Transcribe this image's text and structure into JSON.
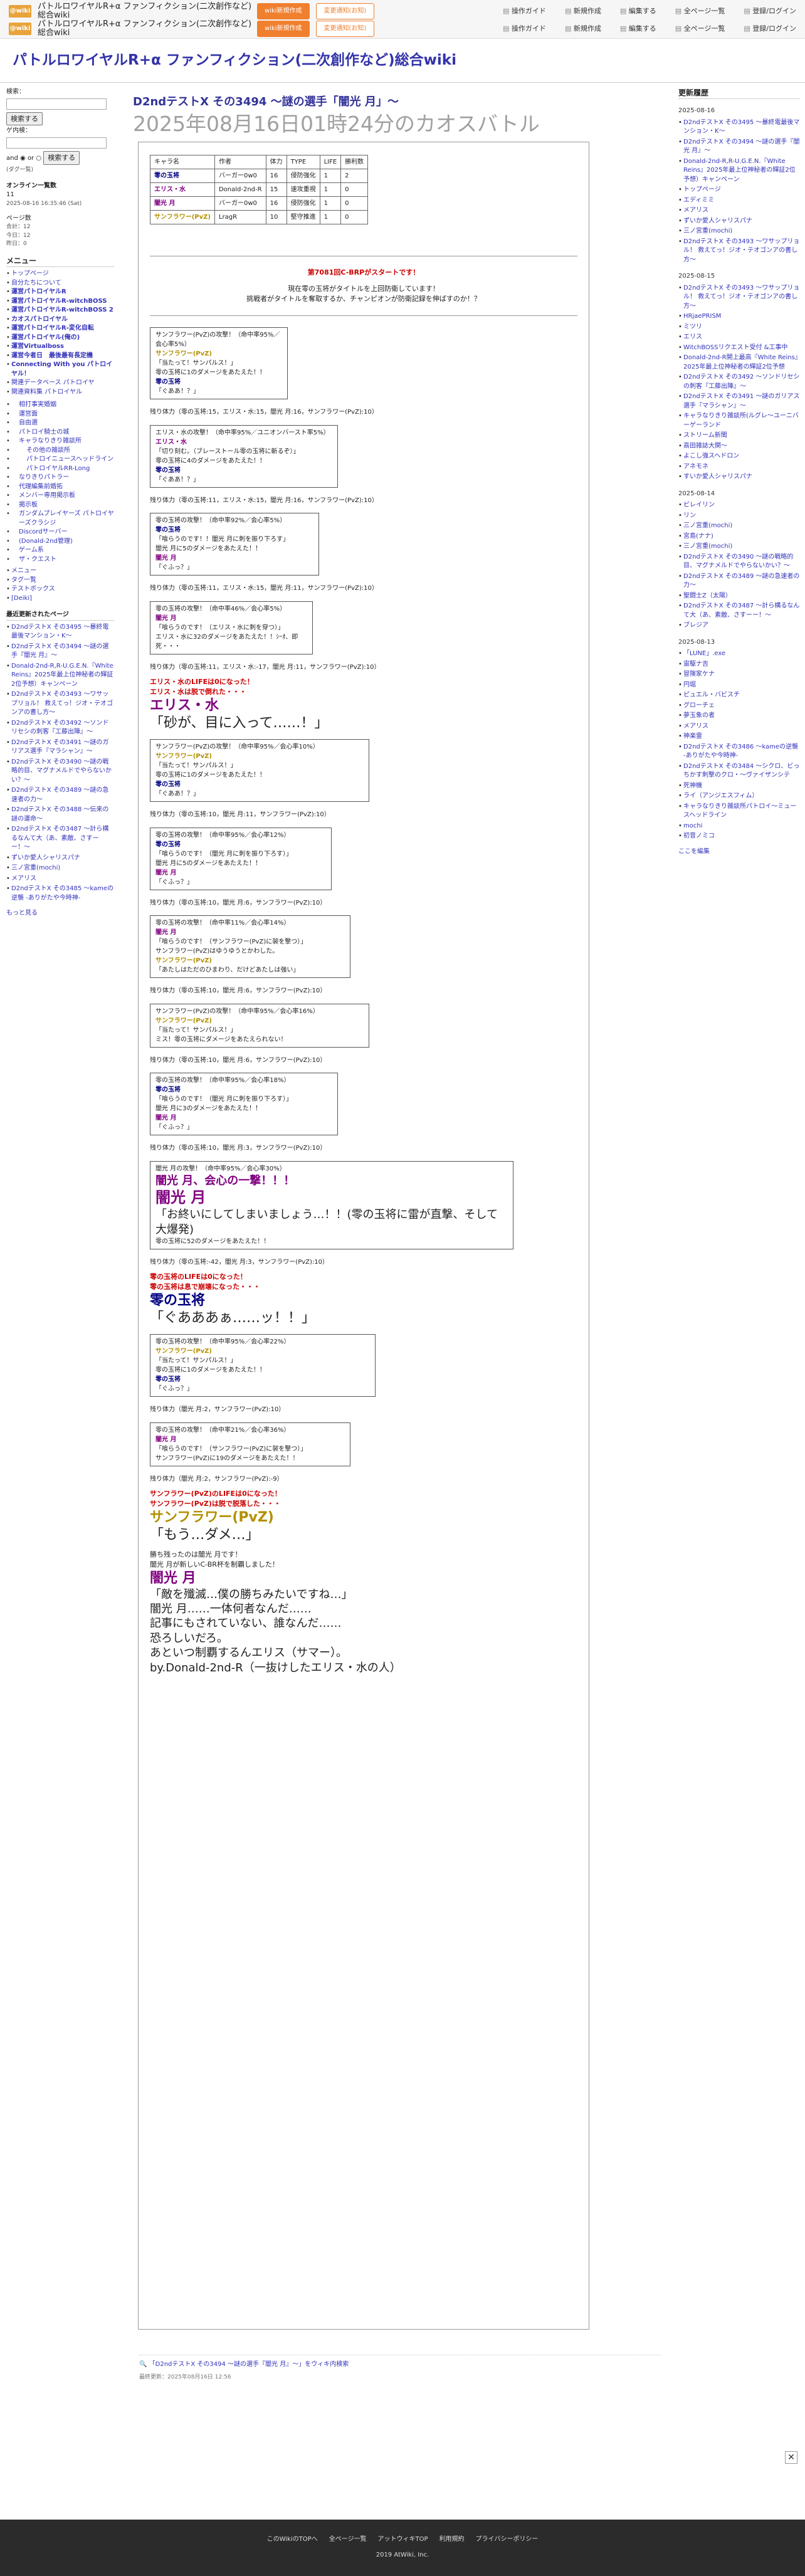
{
  "header": {
    "logo": "@wiki",
    "site_name_1": "パトルロワイヤルR+α ファンフィクション(二次創作など)総合wiki",
    "site_name_2": "パトルロワイヤルR+α ファンフィクション(二次創作など)総合wiki",
    "btn_wiki": "wiki新規作成",
    "btn_change": "変更通知(お知)",
    "nav": [
      "操作ガイド",
      "新規作成",
      "編集する",
      "全ページ一覧",
      "登録/ログイン"
    ]
  },
  "site_title": "パトルロワイヤルR+α ファンフィクション(二次創作など)総合wiki",
  "left": {
    "search_label": "検索：",
    "search_button": "検索する",
    "sub_label": "ゲ内検：",
    "and": "and",
    "or": "or",
    "search_button2": "検索する",
    "tips": "(ダグ一覧)",
    "online_label": "オンライン一覧数",
    "online_count": "11",
    "online_time": "2025-08-16 16:35:46 (Sat)",
    "counter_title": "ページ数",
    "total": "合計：12",
    "today": "今日：12",
    "yesterday": "昨日：0",
    "menu_title": "メニュー",
    "menu": [
      "トップページ",
      "自分たちについて",
      "運営パトロイヤルR",
      "運営パトロイヤルR-witchBOSS",
      "運営パトロイヤルR-witchBOSS 2",
      "カオスパトロイヤル",
      "運営パトロイヤルR-変化自転",
      "運営パトロイヤル(俺の)",
      "運営Virtualboss",
      "運営今者日　最後最有長定機",
      "Connecting With you パトロイヤル！",
      "関連データベース パトロイヤ",
      "関連資料集 パトロイヤル"
    ],
    "menu_sub": [
      "相打事実婚姻",
      "運営面",
      "自由選",
      "パトロイ騎士の城",
      "キャラなりきり雑談所",
      "その他の雑談所",
      "パトロイニュースヘッドライン",
      "パトロイヤルRR-Long",
      "なりきりパトラー",
      "代理編集前婚拓",
      "メンバー専用掲示板",
      "掲示板",
      "ガンダムプレイヤーズ パトロイヤーズクラシジ",
      "Discordサーバー",
      "(Donald-2nd管理)",
      "ゲーム系",
      "ザ・クエスト"
    ],
    "menu_tail": [
      "メニュー",
      "タグ一覧",
      "テストボックス",
      "[Deiki]"
    ],
    "recent_title": "最近更新されたページ",
    "recent": [
      "D2ndテストX その3495 〜暴終電最後マンション・K〜",
      "D2ndテストX その3494 〜謎の選手『闇光 月』〜",
      "Donald-2nd-R,R-U.G.E.N.『White Reins』2025年最上位神秘者の輝証2位予想）キャンペーン",
      "D2ndテストX その3493 〜ワサップリョル！ 救えてっ！ジオ・テオゴンアの書し方〜",
      "D2ndテストX その3492 〜ソンドリセシの刺客『工藤出陣』〜",
      "D2ndテストX その3491 〜謎のガリアス選手『マラシャン』〜",
      "D2ndテストX その3490 〜謎の戦略的目、マグナメルドでやらないかい？〜",
      "D2ndテストX その3489 〜謎の急速者の力〜",
      "D2ndテストX その3488 〜伝来の謎の運命〜",
      "D2ndテストX その3487 〜計ら構るなんて大（あ、素敵、さすーー！〜",
      "ずいか愛人シャリスパナ",
      "三ノ宮重(mochi)",
      "メアリス",
      "D2ndテストX その3485 〜kameの逆襲 -ありがたや今時神-"
    ],
    "more": "もっと見る"
  },
  "right": {
    "title": "更新履歴",
    "groups": [
      {
        "date": "2025-08-16",
        "items": [
          "D2ndテストX その3495 〜暴終電最後マンション・K〜",
          "D2ndテストX その3494 〜謎の選手『闇光 月』〜",
          "Donald-2nd-R,R-U.G.E.N.『White Reins』2025年最上位神秘者の輝証2位予想）キャンペーン",
          "トップページ",
          "エディミミ",
          "メアリス",
          "ずいか愛人シャリスパナ",
          "三ノ宮重(mochi)",
          "D2ndテストX その3493 〜ワサップリョル！ 救えてっ！ジオ・テオゴンアの書し方〜"
        ]
      },
      {
        "date": "2025-08-15",
        "items": [
          "D2ndテストX その3493 〜ワサップリョル！ 救えてっ！ジオ・テオゴンアの書し方〜",
          "HRjaePRISM",
          "ミツリ",
          "エリス",
          "WitchBOSSリクエスト受付 &工事中",
          "Donald-2nd-R開上最高『White Reins』2025年最上位神秘者の輝証2位予想",
          "D2ndテストX その3492 〜ソンドリセシの刺客『工藤出陣』〜",
          "D2ndテストX その3491 〜謎のガリアス選手『マラシャン』〜",
          "キャラなりきり雑談所(ルグレ〜ユーニバーゲーランド",
          "ストリーム新聞",
          "高田雑誌大関〜",
          "よこし強スヘドロン",
          "アネモネ",
          "すいか愛人シャリスパナ"
        ]
      },
      {
        "date": "2025-08-14",
        "items": [
          "ビレイリン",
          "リン",
          "三ノ宮重(mochi)",
          "宮島(ナナ)",
          "三ノ宮重(mochi)",
          "D2ndテストX その3490 〜謎の戦略的目、マグナメルドでやらないかい？〜",
          "D2ndテストX その3489 〜謎の急速者の力〜",
          "聖闘士Z（太陽）",
          "D2ndテストX その3487 〜計ら構るなんて大（あ、素敵、さすーー！〜",
          "ブレジア"
        ]
      },
      {
        "date": "2025-08-13",
        "items": [
          "「LUNE」.exe",
          "宙駆ナ吉",
          "冒険家ケナ",
          "円堀",
          "ピュエル・バビスチ",
          "グローチェ",
          "夢玉象の者",
          "メアリス",
          "神楽霊",
          "D2ndテストX その3486 〜kameの逆襲 -ありがたや今時神-",
          "D2ndテストX その3484 〜シクロ、ビっちかす刺撃のクロ・〜ヴァイザンシテ",
          "死神機",
          "ライ（アンジエスフィム）",
          "キャラなりきり雑談所パトロイ〜ミュースヘッドライン",
          "mochi",
          "初音ノミコ"
        ]
      }
    ],
    "edit": "ここを編集"
  },
  "page": {
    "title": "D2ndテストX その3494 〜謎の選手「闇光 月」〜",
    "subtitle": "2025年08月16日01時24分のカオスバトル",
    "roster_header": [
      "キャラ名",
      "作者",
      "体力",
      "TYPE",
      "LIFE",
      "勝利数"
    ],
    "roster": [
      [
        "零の玉将",
        "バーガー0w0",
        "16",
        "侵防強化",
        "1",
        "2"
      ],
      [
        "エリス・水",
        "Donald-2nd-R",
        "15",
        "速攻重視",
        "1",
        "0"
      ],
      [
        "闇光 月",
        "バーガー0w0",
        "16",
        "侵防強化",
        "1",
        "0"
      ],
      [
        "サンフラワー(PvZ)",
        "LragR",
        "10",
        "堅守推進",
        "1",
        "0"
      ]
    ],
    "announce1": "第7081回C-BRPがスタートです！",
    "announce2": "現在零の玉将がタイトルを上回防衛しています！",
    "announce3": "挑戦者がタイトルを奪取するか、チャンピオンが防衛記録を伸ばすのか！？",
    "status": [
      "残り体力（零の玉将:15，エリス・水:15，闇光 月:16，サンフラワー(PvZ):10）",
      "残り体力（零の玉将:11，エリス・水:15，闇光 月:16，サンフラワー(PvZ):10）",
      "残り体力（零の玉将:11，エリス・水:15，闇光 月:11，サンフラワー(PvZ):10）",
      "残り体力（零の玉将:11，エリス・水:-17，闇光 月:11，サンフラワー(PvZ):10）",
      "残り体力（零の玉将:10，闇光 月:11，サンフラワー(PvZ):10）",
      "残り体力（零の玉将:10，闇光 月:6，サンフラワー(PvZ):10）",
      "残り体力（零の玉将:10，闇光 月:6，サンフラワー(PvZ):10）",
      "残り体力（零の玉将:10，闇光 月:6，サンフラワー(PvZ):10）",
      "残り体力（零の玉将:10，闇光 月:3，サンフラワー(PvZ):10）",
      "残り体力（零の玉将:-42，闇光 月:3，サンフラワー(PvZ):10）",
      "残り体力（闇光 月:2，サンフラワー(PvZ):10）",
      "残り体力（闇光 月:2，サンフラワー(PvZ):-9）"
    ],
    "boxes": [
      [
        "サンフラワー(PvZ)の攻撃！（命中率95%／会心率5%）",
        "サンフラワー(PvZ)",
        "「当たって！サンパルス！」",
        "零の玉将に1のダメージをあたえた！！",
        "零の玉将",
        "「ぐああ！？」"
      ],
      [
        "エリス・水の攻撃！（命中率95%／ユニオンバースト率5%）",
        "エリス・水",
        "「切り刻む。（ブレーストール零の玉将に斬るぞ）」",
        "零の玉将に4のダメージをあたえた！！",
        "零の玉将",
        "「ぐああ！？」"
      ],
      [
        "零の玉将の攻撃！（命中率92%／会心率5%）",
        "零の玉将",
        "「喰らうのです！！闇光 月に刺を振り下ろす」",
        "闇光 月に5のダメージをあたえた！！",
        "闇光 月",
        "「ぐふっ？」"
      ],
      [
        "零の玉将の攻撃！（命中率46%／会心率5%）",
        "闇光 月",
        "「喰らうのです！（エリス・水に刺を穿つ）」",
        "エリス・水に32のダメージをあたえた！！ｼｰｵ、即死・・・"
      ],
      [
        "サンフラワー(PvZ)の攻撃！（命中率95%／会心率10%）",
        "サンフラワー(PvZ)",
        "「当たって！サンパルス！」",
        "零の玉将に1のダメージをあたえた！！",
        "零の玉将",
        "「ぐああ！？」"
      ],
      [
        "零の玉将の攻撃！（命中率95%／会心率12%）",
        "零の玉将",
        "「喰らうのです！（闇光 月に刺を振り下ろす）」",
        "闇光 月に5のダメージをあたえた！！",
        "闇光 月",
        "「ぐふっ？」"
      ],
      [
        "零の玉将の攻撃！（命中率11%／会心率14%）",
        "闇光 月",
        "「喰らうのです！（サンフラワー(PvZ)に袈を撃つ）」",
        "サンフラワー(PvZ)はゆうゆうとかわした。",
        "サンフラワー(PvZ)",
        "「あたしはただのひまわり、だけどあたしは強い」"
      ],
      [
        "サンフラワー(PvZ)の攻撃！（命中率95%／会心率16%）",
        "サンフラワー(PvZ)",
        "「当たって！サンパルス！」",
        "ミス！零の玉将にダメージをあたえられない！"
      ],
      [
        "零の玉将の攻撃！（命中率95%／会心率18%）",
        "零の玉将",
        "「喰らうのです！（闇光 月に刺を振り下ろす）」",
        "闇光 月に3のダメージをあたえた！！",
        "闇光 月",
        "「ぐふっ？」"
      ],
      [
        "零の玉将の攻撃！（命中率95%／会心率22%）",
        "サンフラワー(PvZ)",
        "「当たって！サンパルス！」",
        "零の玉将に1のダメージをあたえた！！",
        "零の玉将",
        "「ぐふっ？」"
      ],
      [
        "零の玉将の攻撃！（命中率21%／会心率36%）",
        "闇光 月",
        "「喰らうのです！（サンフラワー(PvZ)に袈を撃つ）」",
        "サンフラワー(PvZ)に19のダメージをあたえた！！"
      ]
    ],
    "ko1": [
      "エリス・水のLIFEは0になった！",
      "エリス・水は脱で倒れた・・・"
    ],
    "ko1_name": "エリス・水",
    "ko1_line": "「砂が、目に入って……！」",
    "special": {
      "l1": "闇光 月の攻撃！（命中率95%／会心率30%）",
      "l2": "闇光 月、会心の一撃！！！",
      "l3": "闇光 月",
      "l4": "「お終いにしてしまいましょう…！！(零の玉将に雷が直撃、そして大爆発)",
      "l5": "零の玉将に52のダメージをあたえた！！"
    },
    "ko2": [
      "零の玉将のLIFEは0になった！",
      "零の玉将は息で崩壊になった・・・"
    ],
    "ko2_name": "零の玉将",
    "ko2_line": "「ぐあああぁ……ッ！！」",
    "ko3": [
      "サンフラワー(PvZ)のLIFEは0になった！",
      "サンフラワー(PvZ)は脱で脱落した・・・"
    ],
    "ko3_name": "サンフラワー(PvZ)",
    "ko3_line": "「もう…ダメ…」",
    "win1": "勝ち残ったのは闇光 月です！",
    "win2": "闇光 月が新しいC-BR杯を制覇しました！",
    "win_name": "闇光 月",
    "end_lines": [
      "「敵を殲滅…僕の勝ちみたいですね…」",
      "闇光 月……一体何者なんだ……",
      "記事にもされていない、誰なんだ……",
      "恐ろしいだろ。",
      "あといつ制覇するんエリス（サマー）。",
      "by.Donald-2nd-R（一抜けしたエリス・水の人）"
    ],
    "search_link": "「D2ndテストX その3494 〜謎の選手『闇光 月』〜」をウィキ内検索",
    "updated": "最終更新：2025年08月16日 12:56"
  },
  "footer": {
    "links": [
      "このWikiのTOPへ",
      "全ページ一覧",
      "アットウィキTOP",
      "利用規約",
      "プライバシーポリシー"
    ],
    "copy": "2019 AtWiki, Inc."
  },
  "close": "✕"
}
